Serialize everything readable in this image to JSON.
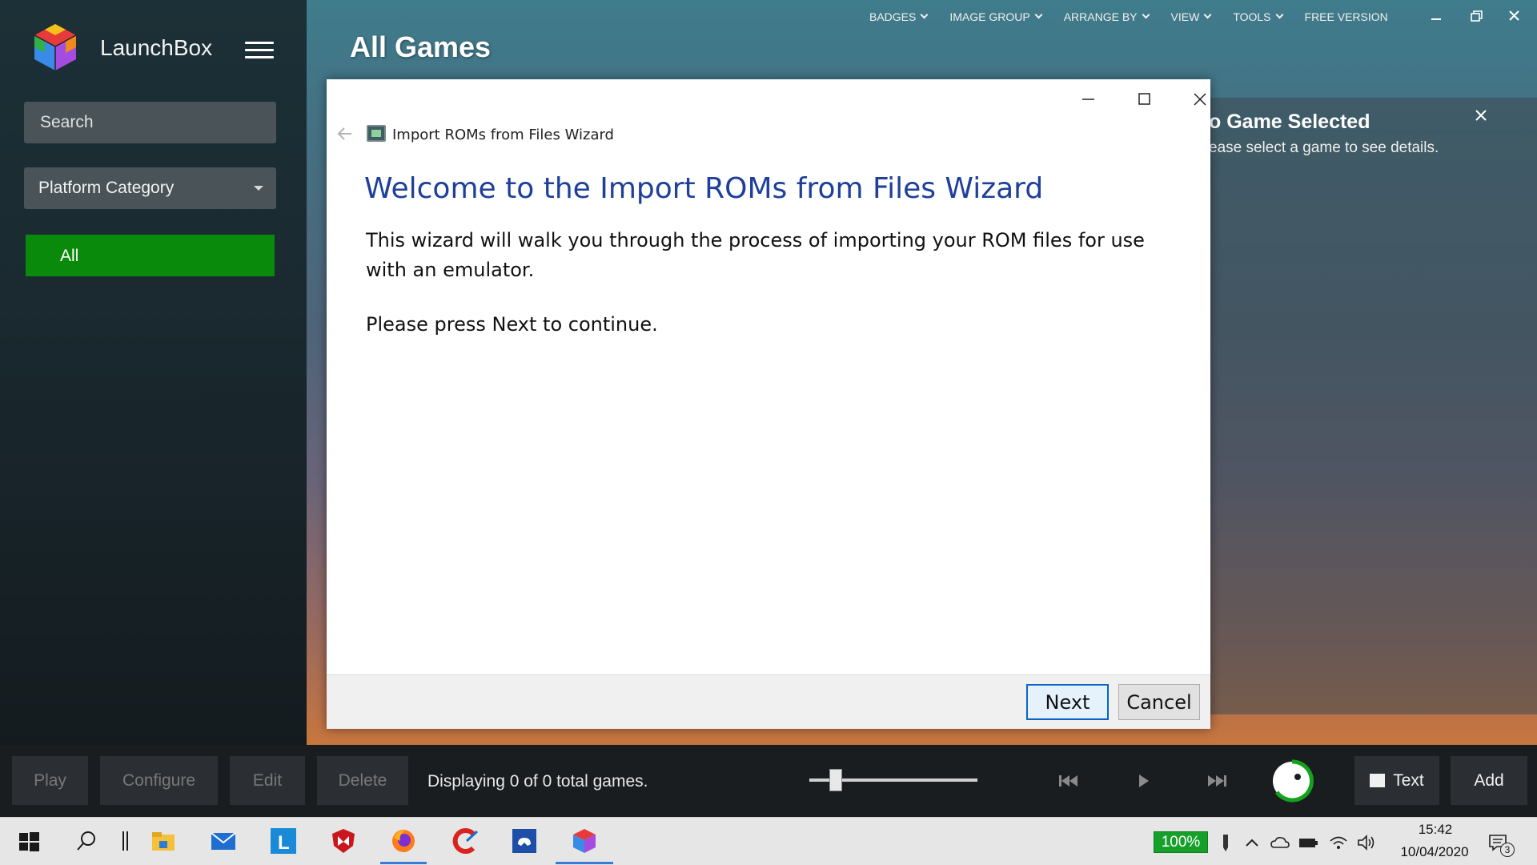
{
  "app": {
    "name": "LaunchBox"
  },
  "sidebar": {
    "search_placeholder": "Search",
    "platform_dropdown": "Platform Category",
    "items": [
      {
        "label": "All",
        "selected": true
      }
    ]
  },
  "main": {
    "title": "All Games"
  },
  "topmenu": {
    "items": [
      "BADGES",
      "IMAGE GROUP",
      "ARRANGE BY",
      "VIEW",
      "TOOLS",
      "FREE VERSION"
    ]
  },
  "details": {
    "title": "o Game Selected",
    "subtitle": "ease select a game to see details."
  },
  "dialog": {
    "window_title": "Import ROMs from Files Wizard",
    "heading": "Welcome to the Import ROMs from Files Wizard",
    "body": "This wizard will walk you through the process of importing your ROM files for use with an emulator.",
    "body2": "Please press Next to continue.",
    "next_label": "Next",
    "cancel_label": "Cancel"
  },
  "bottombar": {
    "buttons": [
      "Play",
      "Configure",
      "Edit",
      "Delete"
    ],
    "status": "Displaying 0 of 0 total games.",
    "text_label": "Text",
    "add_label": "Add"
  },
  "taskbar": {
    "battery": "100%",
    "time": "15:42",
    "date": "10/04/2020",
    "notifications": "3"
  },
  "colors": {
    "accent_green": "#0a8a0a",
    "dialog_heading": "#1e3f9a",
    "next_border": "#0a64c8"
  }
}
